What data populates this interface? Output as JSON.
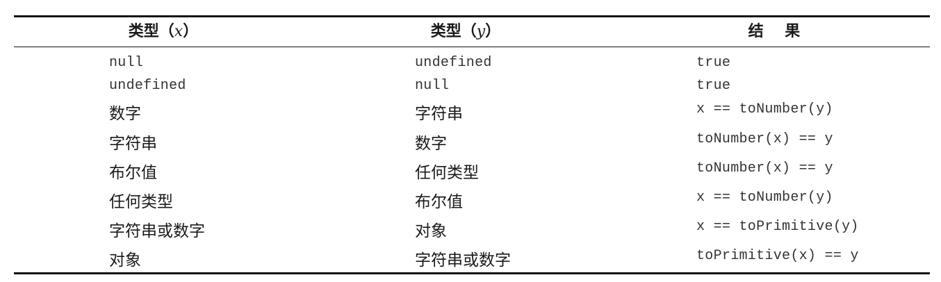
{
  "header": {
    "col1_prefix": "类型（",
    "col1_var": "x",
    "col1_suffix": "）",
    "col2_prefix": "类型（",
    "col2_var": "y",
    "col2_suffix": "）",
    "col3": "结    果"
  },
  "rows": [
    {
      "x": "null",
      "y": "undefined",
      "result": "true",
      "x_code": true,
      "y_code": true
    },
    {
      "x": "undefined",
      "y": "null",
      "result": "true",
      "x_code": true,
      "y_code": true
    },
    {
      "x": "数字",
      "y": "字符串",
      "result": "x == toNumber(y)"
    },
    {
      "x": "字符串",
      "y": "数字",
      "result": "toNumber(x) == y"
    },
    {
      "x": "布尔值",
      "y": "任何类型",
      "result": "toNumber(x) == y"
    },
    {
      "x": "任何类型",
      "y": "布尔值",
      "result": "x == toNumber(y)"
    },
    {
      "x": "字符串或数字",
      "y": "对象",
      "result": "x == toPrimitive(y)"
    },
    {
      "x": "对象",
      "y": "字符串或数字",
      "result": "toPrimitive(x) == y"
    }
  ]
}
